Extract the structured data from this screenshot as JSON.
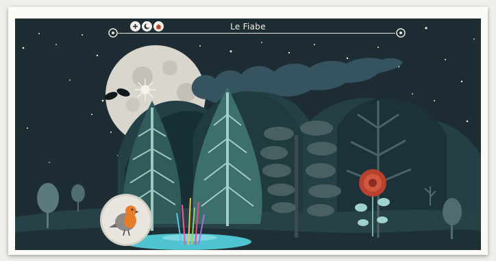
{
  "app": {
    "title": "Le Fiabe"
  },
  "controls": [
    {
      "name": "plus-control",
      "icon": "plus-icon"
    },
    {
      "name": "moon-control",
      "icon": "moon-phase-icon"
    },
    {
      "name": "home-control",
      "icon": "house-icon"
    }
  ],
  "icons": {
    "left_ornament": "swirl-ornament-icon",
    "right_ornament": "swirl-ornament-icon",
    "character_button": "robin-bird-icon"
  },
  "colors": {
    "sky": "#1e2d34",
    "moon": "#d9d6ce",
    "hill_dark": "#1f3b3e",
    "tree_teal": "#3d6f6e",
    "smoke": "#36545f",
    "robin_orange": "#e77d2c",
    "rose_red": "#b8412f",
    "pond": "#4fc3cf"
  }
}
